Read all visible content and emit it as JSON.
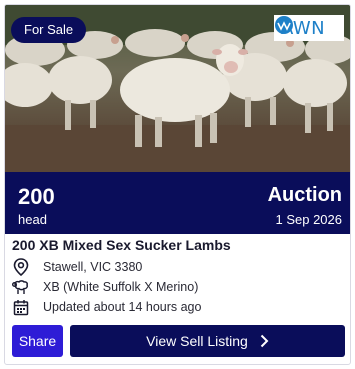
{
  "listing": {
    "badge": "For Sale",
    "logo_text": "AWN",
    "head_count": "200",
    "head_label": "head",
    "sale_type": "Auction",
    "sale_date": "1 Sep 2026",
    "title": "200 XB Mixed Sex Sucker Lambs",
    "location": "Stawell, VIC 3380",
    "breed": "XB (White Suffolk X Merino)",
    "updated": "Updated about 14 hours ago"
  },
  "actions": {
    "share_label": "Share",
    "view_label": "View Sell Listing"
  },
  "icons": {
    "location": "map-pin-icon",
    "breed": "sheep-icon",
    "updated": "calendar-icon",
    "view": "chevron-right-icon"
  },
  "colors": {
    "navy": "#0a0d5a",
    "share_blue": "#2e1cd6",
    "logo_blue": "#1e80c8"
  }
}
